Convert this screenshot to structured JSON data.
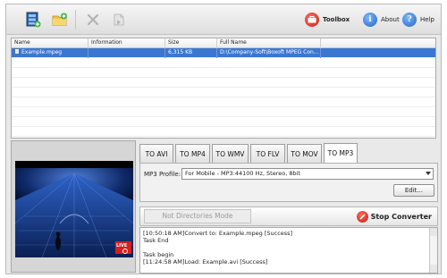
{
  "toolbar": {
    "add_file_icon": "add-video-icon",
    "add_folder_icon": "add-folder-icon",
    "delete_icon": "delete-icon",
    "convert_icon": "convert-icon",
    "toolbox_label": "Toolbox",
    "about_label": "About",
    "help_label": "Help"
  },
  "filelist": {
    "headers": {
      "name": "Name",
      "information": "Information",
      "size": "Size",
      "fullname": "Full Name"
    },
    "rows": [
      {
        "name": "Example.mpeg",
        "information": "",
        "size": "6,315 KB",
        "fullname": "D:\\Company-Soft\\Boxoft MPEG Con...",
        "selected": true
      }
    ]
  },
  "tabs": {
    "items": [
      "TO AVI",
      "TO MP4",
      "TO WMV",
      "TO FLV",
      "TO MOV",
      "TO MP3"
    ],
    "active": "TO MP3"
  },
  "profile": {
    "label": "MP3 Profile:",
    "value": "For Mobile - MP3:44100 Hz, Stereo, 8bit",
    "edit_label": "Edit..."
  },
  "actions": {
    "not_directories_label": "Not Directories Mode",
    "stop_label": "Stop Converter"
  },
  "log": {
    "lines": [
      "[10:50:18 AM]Convert to: Example.mpeg [Success]",
      "Task End",
      "",
      "Task begin",
      "[11:24:58 AM]Load: Example.avi [Success]"
    ]
  },
  "preview": {
    "live_badge": "LIVE"
  },
  "colors": {
    "selection": "#3b77d1",
    "stop_red": "#c81d10",
    "toolbox_red": "#d42b1f",
    "info_blue": "#2f7bd8"
  }
}
